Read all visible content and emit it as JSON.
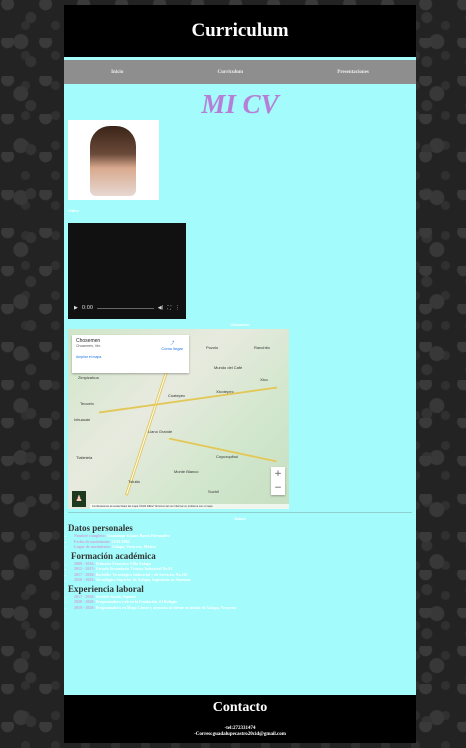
{
  "header": {
    "title": "Curriculum"
  },
  "nav": {
    "items": [
      {
        "label": "Inicio"
      },
      {
        "label": "Curriculum"
      },
      {
        "label": "Presentaciones"
      }
    ]
  },
  "main": {
    "heading": "MI CV",
    "photo_label": "Video",
    "video": {
      "time": "0:00"
    },
    "map_label": "Ubicacion",
    "map": {
      "place": "Chosemen",
      "place_sub": "Chosemén, Ver.",
      "directions": "Cómo llegar",
      "enlarge": "Ampliar el mapa",
      "towns": [
        "Pozolo",
        "Ranchito",
        "Coatepec",
        "Mundo del Café",
        "Xico",
        "Zimpizahua",
        "Xicotepec",
        "Teocelo",
        "Llano Grande",
        "Ixhuacán",
        "Tlaltetela",
        "Monte Blanco",
        "Cuyuxquihui",
        "Totutla",
        "Suchil"
      ],
      "footer": "Combinaciones de teclas   Datos del mapa ©2024 INEGI   Términos del uso   Informar un problema con el mapa"
    },
    "data_label": "Datos",
    "personal": {
      "title": "Datos personales",
      "items": [
        {
          "key": "Nombre completo:",
          "value": "Guadalupe Gómez Baeza Hernandez"
        },
        {
          "key": "Fecha de nacimiento:",
          "value": "21/01/2004"
        },
        {
          "key": "Lugar de nacimiento:",
          "value": "Xalapa, Veracruz, México"
        }
      ]
    },
    "education": {
      "title": "Formación académica",
      "items": [
        {
          "key": "2009 - 2015:",
          "value": "Primaria Francisco Villa Xalapa"
        },
        {
          "key": "2015 - 2017:",
          "value": "Escuela Secundaria Técnica Industrial No.91"
        },
        {
          "key": "2017 - 2020:",
          "value": "Bachiller Tecnológico Industrial y de Servicios No.165"
        },
        {
          "key": "2020 - 2025:",
          "value": "Tecnológico Superior de Xalapa, Ingeniería en Sistemas"
        }
      ]
    },
    "experience": {
      "title": "Experiencia laboral",
      "items": [
        {
          "key": "2017 - 2020:",
          "value": "Servicio Social, Soporte"
        },
        {
          "key": "2020 - 2020:",
          "value": "Programadora web en la Fundación, El Refugio"
        },
        {
          "key": "2019 - 2020:",
          "value": "Programadora en Mega Center y atención al cliente en tienda de Xalapa, Veracruz"
        }
      ]
    }
  },
  "contact": {
    "title": "Contacto",
    "phone": "-tel:272331474",
    "email": "-Correo:guadalupecastro20cid@gmail.com"
  },
  "colors": {
    "page_bg": "#a3fbfb",
    "accent": "#b67ed6",
    "header_bg": "#000000",
    "nav_bg": "#8e8e8e"
  }
}
